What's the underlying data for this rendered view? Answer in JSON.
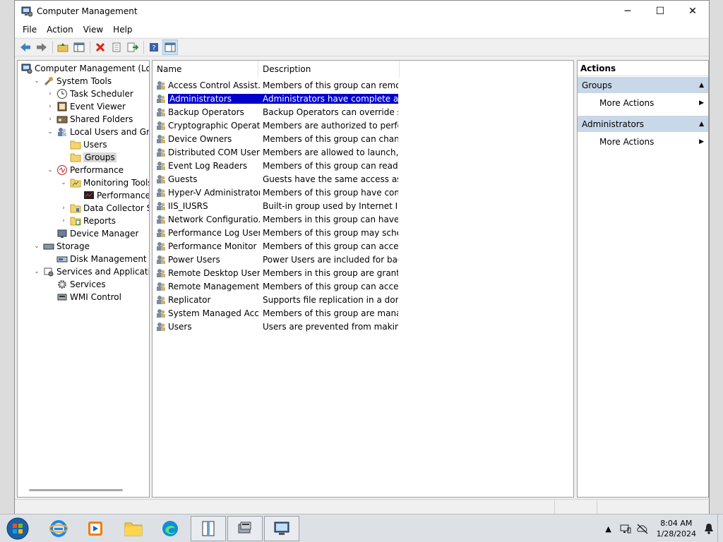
{
  "window": {
    "title": "Computer Management",
    "controls": {
      "minimize": "─",
      "maximize": "☐",
      "close": "✕"
    }
  },
  "menu": [
    "File",
    "Action",
    "View",
    "Help"
  ],
  "toolbar": [
    {
      "name": "back-icon"
    },
    {
      "name": "forward-icon"
    },
    {
      "name": "up-folder-icon"
    },
    {
      "name": "show-hide-console-tree-icon"
    },
    {
      "name": "delete-icon"
    },
    {
      "name": "properties-icon"
    },
    {
      "name": "export-list-icon"
    },
    {
      "name": "help-icon"
    },
    {
      "name": "show-action-pane-icon"
    }
  ],
  "tree": [
    {
      "label": "Computer Management (Local",
      "level": 0,
      "exp": "",
      "icon": "computer-management-icon"
    },
    {
      "label": "System Tools",
      "level": 1,
      "exp": "v",
      "icon": "tools-icon"
    },
    {
      "label": "Task Scheduler",
      "level": 2,
      "exp": ">",
      "icon": "clock-icon"
    },
    {
      "label": "Event Viewer",
      "level": 2,
      "exp": ">",
      "icon": "event-viewer-icon"
    },
    {
      "label": "Shared Folders",
      "level": 2,
      "exp": ">",
      "icon": "shared-folder-icon"
    },
    {
      "label": "Local Users and Groups",
      "level": 2,
      "exp": "v",
      "icon": "users-groups-icon"
    },
    {
      "label": "Users",
      "level": 3,
      "exp": "",
      "icon": "folder-icon"
    },
    {
      "label": "Groups",
      "level": 3,
      "exp": "",
      "icon": "folder-icon",
      "selected": true
    },
    {
      "label": "Performance",
      "level": 2,
      "exp": "v",
      "icon": "performance-icon"
    },
    {
      "label": "Monitoring Tools",
      "level": 3,
      "exp": "v",
      "icon": "folder-chart-icon"
    },
    {
      "label": "Performance Mc",
      "level": 4,
      "exp": "",
      "icon": "monitor-chart-icon"
    },
    {
      "label": "Data Collector Sets",
      "level": 3,
      "exp": ">",
      "icon": "data-collector-icon"
    },
    {
      "label": "Reports",
      "level": 3,
      "exp": ">",
      "icon": "reports-icon"
    },
    {
      "label": "Device Manager",
      "level": 2,
      "exp": "",
      "icon": "device-manager-icon"
    },
    {
      "label": "Storage",
      "level": 1,
      "exp": "v",
      "icon": "storage-icon"
    },
    {
      "label": "Disk Management",
      "level": 2,
      "exp": "",
      "icon": "disk-management-icon"
    },
    {
      "label": "Services and Applications",
      "level": 1,
      "exp": "v",
      "icon": "services-apps-icon"
    },
    {
      "label": "Services",
      "level": 2,
      "exp": "",
      "icon": "services-gear-icon"
    },
    {
      "label": "WMI Control",
      "level": 2,
      "exp": "",
      "icon": "wmi-icon"
    }
  ],
  "list": {
    "columns": [
      "Name",
      "Description"
    ],
    "rows": [
      {
        "name": "Access Control Assist...",
        "desc": "Members of this group can remot..."
      },
      {
        "name": "Administrators",
        "desc": "Administrators have complete an...",
        "selected": true
      },
      {
        "name": "Backup Operators",
        "desc": "Backup Operators can override se..."
      },
      {
        "name": "Cryptographic Operat...",
        "desc": "Members are authorized to perfor..."
      },
      {
        "name": "Device Owners",
        "desc": "Members of this group can chang..."
      },
      {
        "name": "Distributed COM Users",
        "desc": "Members are allowed to launch, a..."
      },
      {
        "name": "Event Log Readers",
        "desc": "Members of this group can read e..."
      },
      {
        "name": "Guests",
        "desc": "Guests have the same access as m..."
      },
      {
        "name": "Hyper-V Administrators",
        "desc": "Members of this group have com..."
      },
      {
        "name": "IIS_IUSRS",
        "desc": "Built-in group used by Internet Inf..."
      },
      {
        "name": "Network Configuratio...",
        "desc": "Members in this group can have s..."
      },
      {
        "name": "Performance Log Users",
        "desc": "Members of this group may sche..."
      },
      {
        "name": "Performance Monitor ...",
        "desc": "Members of this group can acces..."
      },
      {
        "name": "Power Users",
        "desc": "Power Users are included for back..."
      },
      {
        "name": "Remote Desktop Users",
        "desc": "Members in this group are grante..."
      },
      {
        "name": "Remote Management...",
        "desc": "Members of this group can acces..."
      },
      {
        "name": "Replicator",
        "desc": "Supports file replication in a dom..."
      },
      {
        "name": "System Managed Acc...",
        "desc": "Members of this group are mana..."
      },
      {
        "name": "Users",
        "desc": "Users are prevented from making ..."
      }
    ]
  },
  "actions": {
    "title": "Actions",
    "sections": [
      {
        "label": "Groups",
        "item": "More Actions"
      },
      {
        "label": "Administrators",
        "item": "More Actions"
      }
    ]
  },
  "taskbar": {
    "apps": [
      "internet-explorer-icon",
      "media-player-icon",
      "file-explorer-icon",
      "edge-icon",
      "notepad-icon",
      "server-manager-icon",
      "computer-management-icon"
    ],
    "time": "8:04 AM",
    "date": "1/28/2024"
  },
  "colors": {
    "selection": "#0000cd",
    "section_header": "#c8d8e8",
    "taskbar": "#dde1e6"
  }
}
